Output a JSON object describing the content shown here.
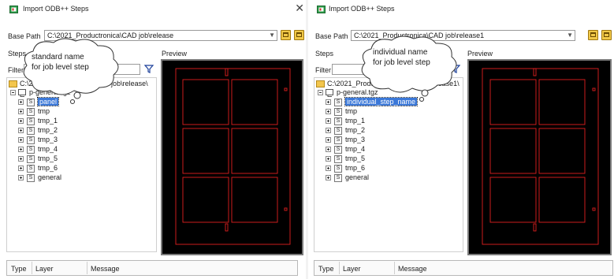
{
  "left": {
    "title": "Import ODB++ Steps",
    "base_path_label": "Base Path",
    "base_path_value": "C:\\2021_Productronica\\CAD job\\release",
    "steps_label": "Steps",
    "filter_label": "Filter",
    "preview_label": "Preview",
    "tree_root": "C:\\2021_Productronica\\CAD job\\release\\",
    "job_name": "p-general.tgz",
    "steps": [
      "panel",
      "tmp",
      "tmp_1",
      "tmp_2",
      "tmp_3",
      "tmp_4",
      "tmp_5",
      "tmp_6",
      "general"
    ],
    "selected_step": "panel",
    "callout": [
      "standard  name",
      "for job level step"
    ],
    "columns": [
      "Type",
      "Layer",
      "Message"
    ]
  },
  "right": {
    "title": "Import ODB++ Steps",
    "base_path_value": "C:\\2021_Productronica\\CAD job\\release1",
    "base_path_label": "Base Path",
    "steps_label": "Steps",
    "filter_label": "Filter",
    "preview_label": "Preview",
    "tree_root": "C:\\2021_Productronica\\CAD job\\release1\\",
    "job_name": "p-general.tgz",
    "steps": [
      "individual_step_name",
      "tmp",
      "tmp_1",
      "tmp_2",
      "tmp_3",
      "tmp_4",
      "tmp_5",
      "tmp_6",
      "general"
    ],
    "selected_step": "individual_step_name",
    "callout": [
      "individual  name",
      "for job level step"
    ],
    "columns": [
      "Type",
      "Layer",
      "Message"
    ]
  },
  "colors": {
    "board_outline": "#e02020",
    "selection": "#3b78d8",
    "preview_bg": "#000000"
  }
}
